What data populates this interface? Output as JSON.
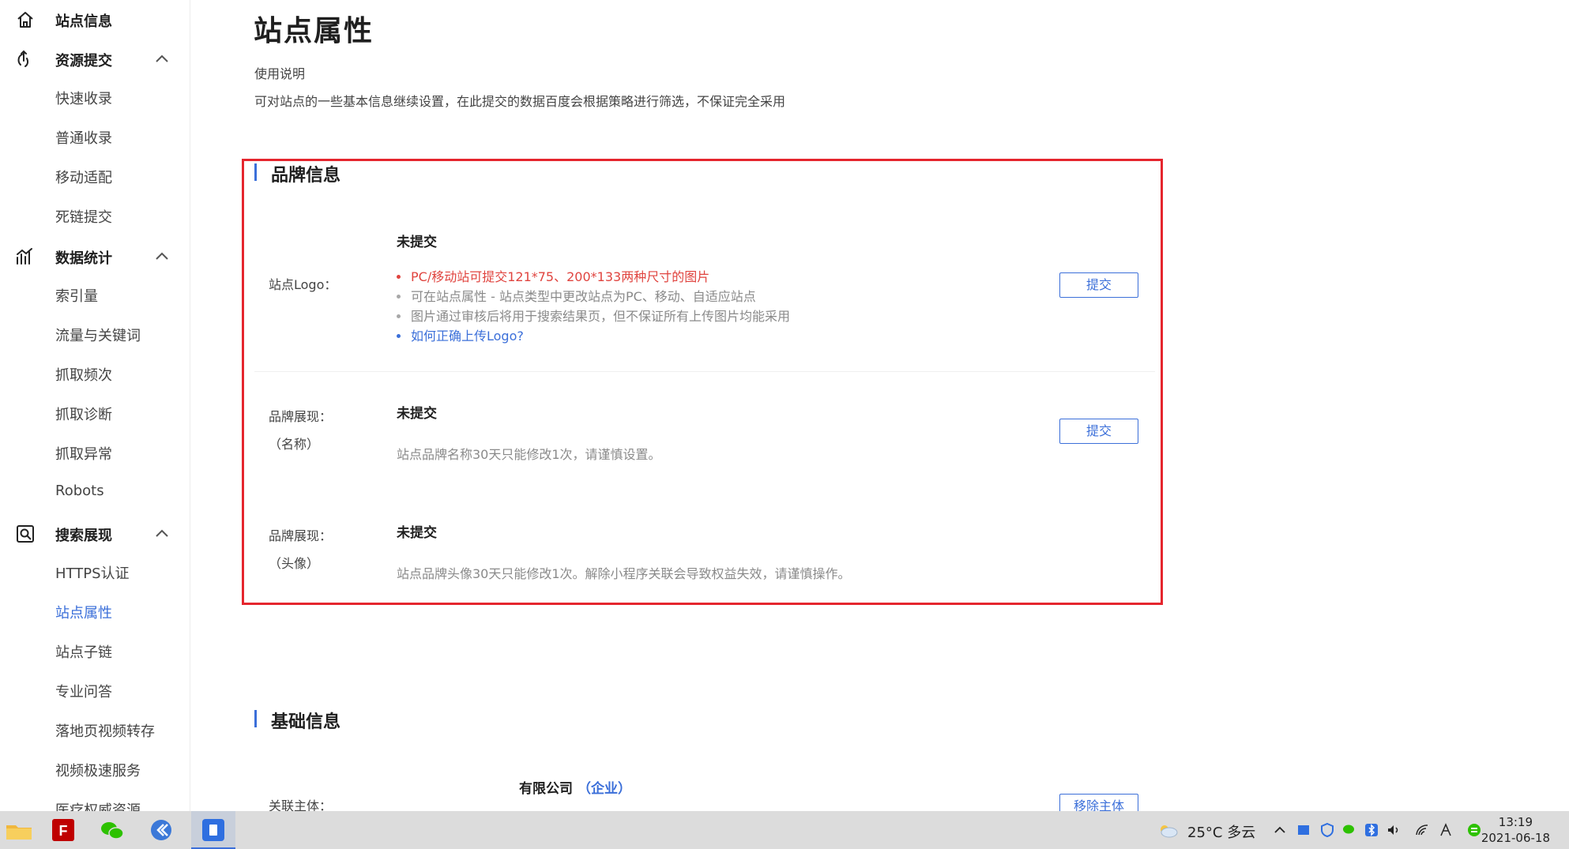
{
  "sidebar": {
    "site_info": "站点信息",
    "resource_submit": {
      "label": "资源提交",
      "items": [
        "快速收录",
        "普通收录",
        "移动适配",
        "死链提交"
      ]
    },
    "data_stats": {
      "label": "数据统计",
      "items": [
        "索引量",
        "流量与关键词",
        "抓取频次",
        "抓取诊断",
        "抓取异常",
        "Robots"
      ]
    },
    "search_display": {
      "label": "搜索展现",
      "items": [
        "HTTPS认证",
        "站点属性",
        "站点子链",
        "专业问答",
        "落地页视频转存",
        "视频极速服务",
        "医疗权威资源"
      ],
      "active": "站点属性"
    },
    "active_color": "#3b6fd9"
  },
  "main": {
    "title": "站点属性",
    "usage_title": "使用说明",
    "usage_desc": "可对站点的一些基本信息继续设置，在此提交的数据百度会根据策略进行筛选，不保证完全采用",
    "brand": {
      "section_title": "品牌信息",
      "logo": {
        "label": "站点Logo：",
        "status": "未提交",
        "bullets": [
          "PC/移动站可提交121*75、200*133两种尺寸的图片",
          "可在站点属性 - 站点类型中更改站点为PC、移动、自适应站点",
          "图片通过审核后将用于搜索结果页，但不保证所有上传图片均能采用",
          "如何正确上传Logo?"
        ],
        "button": "提交"
      },
      "name": {
        "label_line1": "品牌展现：",
        "label_line2": "（名称）",
        "status": "未提交",
        "hint": "站点品牌名称30天只能修改1次，请谨慎设置。",
        "button": "提交"
      },
      "avatar": {
        "label_line1": "品牌展现：",
        "label_line2": "（头像）",
        "status": "未提交",
        "hint": "站点品牌头像30天只能修改1次。解除小程序关联会导致权益失效，请谨慎操作。"
      }
    },
    "basic": {
      "section_title": "基础信息",
      "entity_label": "关联主体：",
      "company": "有限公司",
      "company_type": "（企业）",
      "remove_button": "移除主体"
    },
    "highlight_color": "#e5262e"
  },
  "taskbar": {
    "weather": "25°C  多云",
    "time": "13:19",
    "date": "2021-06-18",
    "apps": [
      "file-explorer-icon",
      "filezilla-icon",
      "wechat-icon",
      "browser-icon",
      "notes-icon"
    ]
  }
}
